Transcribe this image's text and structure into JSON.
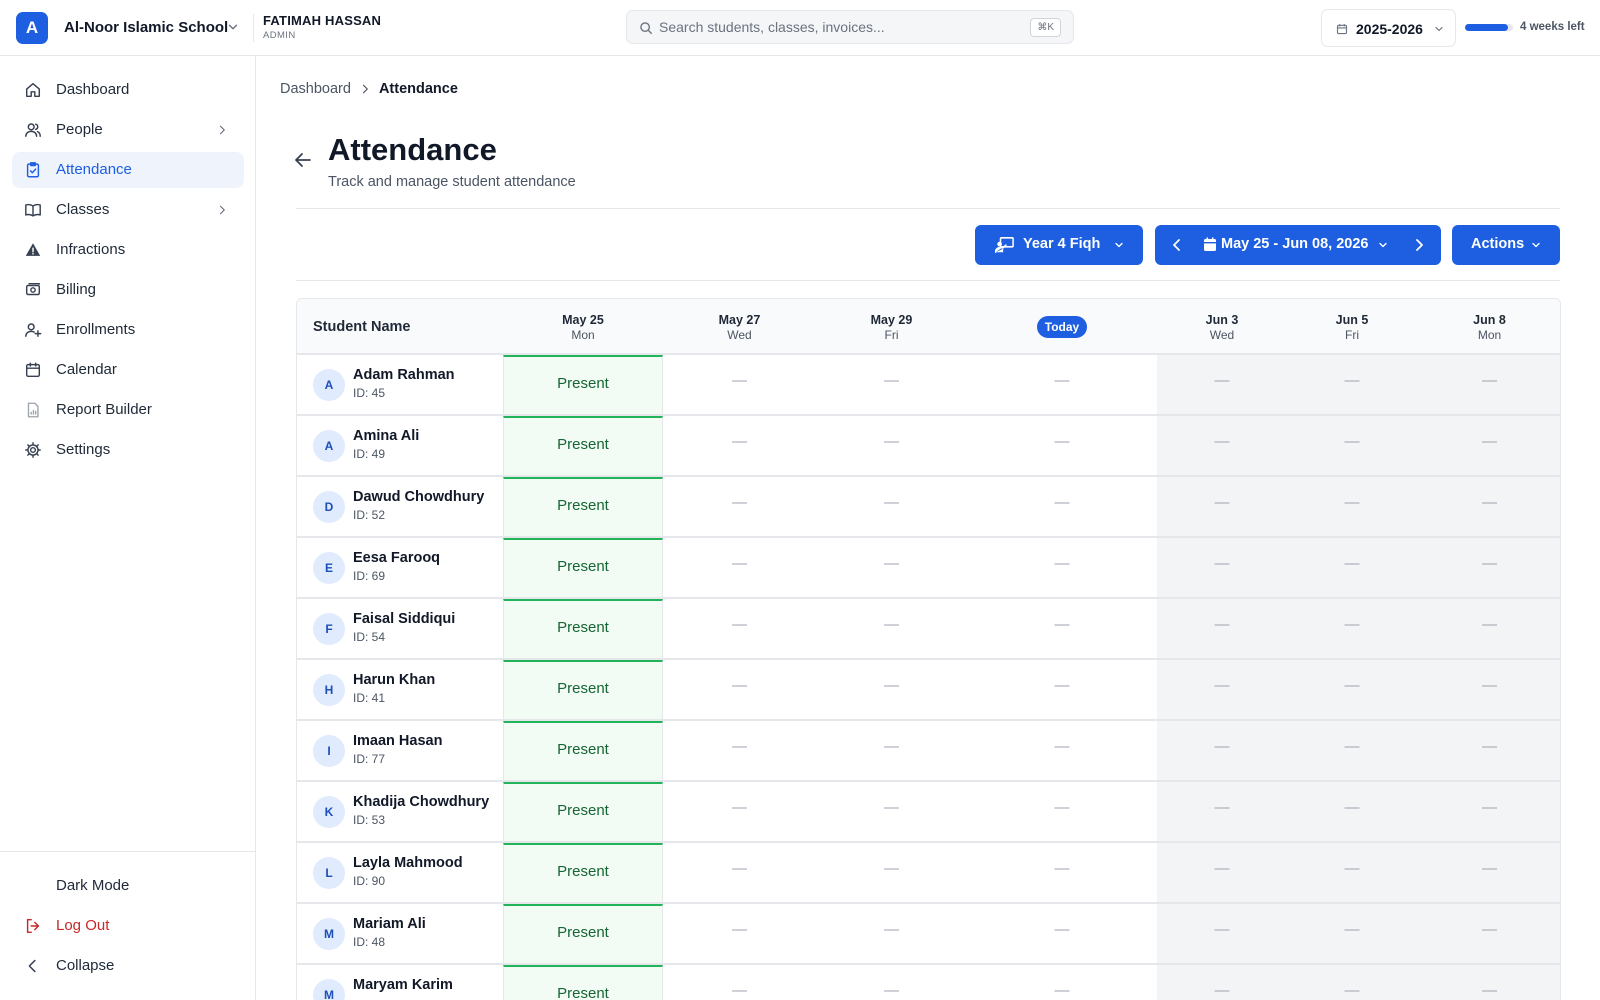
{
  "org": {
    "initial": "A",
    "name": "Al-Noor Islamic School"
  },
  "user": {
    "name": "FATIMAH HASSAN",
    "role": "ADMIN"
  },
  "search": {
    "placeholder": "Search students, classes, invoices...",
    "shortcut": "⌘K"
  },
  "year": {
    "label": "2025-2026"
  },
  "term_progress": {
    "label": "4 weeks left",
    "percent": 90
  },
  "sidebar": {
    "items": [
      {
        "label": "Dashboard",
        "icon": "home-icon",
        "active": false,
        "has_children": false
      },
      {
        "label": "People",
        "icon": "users-icon",
        "active": false,
        "has_children": true
      },
      {
        "label": "Attendance",
        "icon": "clipboard-check-icon",
        "active": true,
        "has_children": false
      },
      {
        "label": "Classes",
        "icon": "book-open-icon",
        "active": false,
        "has_children": true
      },
      {
        "label": "Infractions",
        "icon": "warning-icon",
        "active": false,
        "has_children": false
      },
      {
        "label": "Billing",
        "icon": "cash-icon",
        "active": false,
        "has_children": false
      },
      {
        "label": "Enrollments",
        "icon": "user-plus-icon",
        "active": false,
        "has_children": false
      },
      {
        "label": "Calendar",
        "icon": "calendar-icon",
        "active": false,
        "has_children": false
      },
      {
        "label": "Report Builder",
        "icon": "report-icon",
        "active": false,
        "has_children": false
      },
      {
        "label": "Settings",
        "icon": "gear-icon",
        "active": false,
        "has_children": false
      }
    ],
    "footer": [
      {
        "label": "Dark Mode",
        "icon": "moon-icon"
      },
      {
        "label": "Log Out",
        "icon": "logout-icon"
      },
      {
        "label": "Collapse",
        "icon": "chevron-left-icon"
      }
    ]
  },
  "breadcrumb": {
    "parent": "Dashboard",
    "current": "Attendance"
  },
  "page": {
    "title": "Attendance",
    "subtitle": "Track and manage student attendance"
  },
  "toolbar": {
    "class_label": "Year 4 Fiqh",
    "range_label": "May 25 - Jun 08, 2026",
    "actions_label": "Actions"
  },
  "table": {
    "name_header": "Student Name",
    "columns": [
      {
        "date": "May 25",
        "dow": "Mon",
        "today": false,
        "shaded": false
      },
      {
        "date": "May 27",
        "dow": "Wed",
        "today": false,
        "shaded": false
      },
      {
        "date": "May 29",
        "dow": "Fri",
        "today": false,
        "shaded": false
      },
      {
        "date": "Today",
        "dow": "",
        "today": true,
        "shaded": false
      },
      {
        "date": "Jun 3",
        "dow": "Wed",
        "today": false,
        "shaded": true
      },
      {
        "date": "Jun 5",
        "dow": "Fri",
        "today": false,
        "shaded": true
      },
      {
        "date": "Jun 8",
        "dow": "Mon",
        "today": false,
        "shaded": true
      }
    ],
    "empty_mark": "—",
    "rows": [
      {
        "initial": "A",
        "name": "Adam Rahman",
        "id": "ID: 45",
        "statuses": [
          "Present",
          "",
          "",
          "",
          "",
          "",
          ""
        ]
      },
      {
        "initial": "A",
        "name": "Amina Ali",
        "id": "ID: 49",
        "statuses": [
          "Present",
          "",
          "",
          "",
          "",
          "",
          ""
        ]
      },
      {
        "initial": "D",
        "name": "Dawud Chowdhury",
        "id": "ID: 52",
        "statuses": [
          "Present",
          "",
          "",
          "",
          "",
          "",
          ""
        ]
      },
      {
        "initial": "E",
        "name": "Eesa Farooq",
        "id": "ID: 69",
        "statuses": [
          "Present",
          "",
          "",
          "",
          "",
          "",
          ""
        ]
      },
      {
        "initial": "F",
        "name": "Faisal Siddiqui",
        "id": "ID: 54",
        "statuses": [
          "Present",
          "",
          "",
          "",
          "",
          "",
          ""
        ]
      },
      {
        "initial": "H",
        "name": "Harun Khan",
        "id": "ID: 41",
        "statuses": [
          "Present",
          "",
          "",
          "",
          "",
          "",
          ""
        ]
      },
      {
        "initial": "I",
        "name": "Imaan Hasan",
        "id": "ID: 77",
        "statuses": [
          "Present",
          "",
          "",
          "",
          "",
          "",
          ""
        ]
      },
      {
        "initial": "K",
        "name": "Khadija Chowdhury",
        "id": "ID: 53",
        "statuses": [
          "Present",
          "",
          "",
          "",
          "",
          "",
          ""
        ]
      },
      {
        "initial": "L",
        "name": "Layla Mahmood",
        "id": "ID: 90",
        "statuses": [
          "Present",
          "",
          "",
          "",
          "",
          "",
          ""
        ]
      },
      {
        "initial": "M",
        "name": "Mariam Ali",
        "id": "ID: 48",
        "statuses": [
          "Present",
          "",
          "",
          "",
          "",
          "",
          ""
        ]
      },
      {
        "initial": "M",
        "name": "Maryam Karim",
        "id": "",
        "statuses": [
          "Present",
          "",
          "",
          "",
          "",
          "",
          ""
        ]
      }
    ]
  },
  "colors": {
    "accent": "#1d5fe0",
    "present_text": "#166534",
    "present_border": "#22b45a",
    "danger": "#c62828"
  }
}
